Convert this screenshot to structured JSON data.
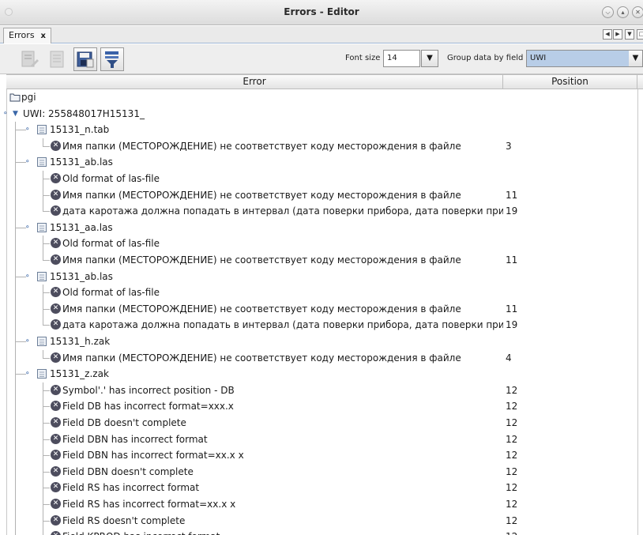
{
  "window": {
    "title": "Errors - Editor"
  },
  "tabs": [
    {
      "label": "Errors",
      "close": "x"
    }
  ],
  "toolbar": {
    "font_size_label": "Font size",
    "font_size_value": "14",
    "group_label": "Group data by field",
    "group_value": "UWI"
  },
  "table": {
    "columns": [
      "Error",
      "Position"
    ],
    "rows": [
      {
        "kind": "root",
        "level": 0,
        "text": "pgi",
        "pos": ""
      },
      {
        "kind": "group",
        "level": 1,
        "text": "UWI: 255848017H15131_",
        "pos": ""
      },
      {
        "kind": "file",
        "level": 2,
        "text": "15131_n.tab",
        "pos": ""
      },
      {
        "kind": "error",
        "level": 3,
        "text": "Имя папки (МЕСТОРОЖДЕНИЕ) не соответствует коду месторождения в файле",
        "pos": "3"
      },
      {
        "kind": "file",
        "level": 2,
        "text": "15131_ab.las",
        "pos": ""
      },
      {
        "kind": "error",
        "level": 3,
        "text": "Old format of las-file",
        "pos": ""
      },
      {
        "kind": "error",
        "level": 3,
        "text": "Имя папки (МЕСТОРОЖДЕНИЕ) не соответствует коду месторождения в файле",
        "pos": "11"
      },
      {
        "kind": "error",
        "level": 3,
        "text": "дата каротажа должна попадать в интервал (дата поверки прибора, дата поверки прибора)",
        "pos": "19"
      },
      {
        "kind": "file",
        "level": 2,
        "text": "15131_aa.las",
        "pos": ""
      },
      {
        "kind": "error",
        "level": 3,
        "text": "Old format of las-file",
        "pos": ""
      },
      {
        "kind": "error",
        "level": 3,
        "text": "Имя папки (МЕСТОРОЖДЕНИЕ) не соответствует коду месторождения в файле",
        "pos": "11"
      },
      {
        "kind": "file",
        "level": 2,
        "text": "15131_ab.las",
        "pos": ""
      },
      {
        "kind": "error",
        "level": 3,
        "text": "Old format of las-file",
        "pos": ""
      },
      {
        "kind": "error",
        "level": 3,
        "text": "Имя папки (МЕСТОРОЖДЕНИЕ) не соответствует коду месторождения в файле",
        "pos": "11"
      },
      {
        "kind": "error",
        "level": 3,
        "text": "дата каротажа должна попадать в интервал (дата поверки прибора, дата поверки прибора)",
        "pos": "19"
      },
      {
        "kind": "file",
        "level": 2,
        "text": "15131_h.zak",
        "pos": ""
      },
      {
        "kind": "error",
        "level": 3,
        "text": "Имя папки (МЕСТОРОЖДЕНИЕ) не соответствует коду месторождения в файле",
        "pos": "4"
      },
      {
        "kind": "file",
        "level": 2,
        "text": "15131_z.zak",
        "pos": ""
      },
      {
        "kind": "error",
        "level": 3,
        "text": "Symbol'.' has incorrect position - DB",
        "pos": "12"
      },
      {
        "kind": "error",
        "level": 3,
        "text": "Field DB has incorrect format=xxx.x",
        "pos": "12"
      },
      {
        "kind": "error",
        "level": 3,
        "text": "Field DB doesn't complete",
        "pos": "12"
      },
      {
        "kind": "error",
        "level": 3,
        "text": "Field DBN has incorrect format",
        "pos": "12"
      },
      {
        "kind": "error",
        "level": 3,
        "text": "Field DBN has incorrect format=xx.x x",
        "pos": "12"
      },
      {
        "kind": "error",
        "level": 3,
        "text": "Field DBN doesn't complete",
        "pos": "12"
      },
      {
        "kind": "error",
        "level": 3,
        "text": "Field RS has incorrect format",
        "pos": "12"
      },
      {
        "kind": "error",
        "level": 3,
        "text": "Field RS has incorrect format=xx.x x",
        "pos": "12"
      },
      {
        "kind": "error",
        "level": 3,
        "text": "Field RS doesn't complete",
        "pos": "12"
      },
      {
        "kind": "error",
        "level": 3,
        "text": "Field KPROD has incorrect format",
        "pos": "12"
      }
    ]
  }
}
